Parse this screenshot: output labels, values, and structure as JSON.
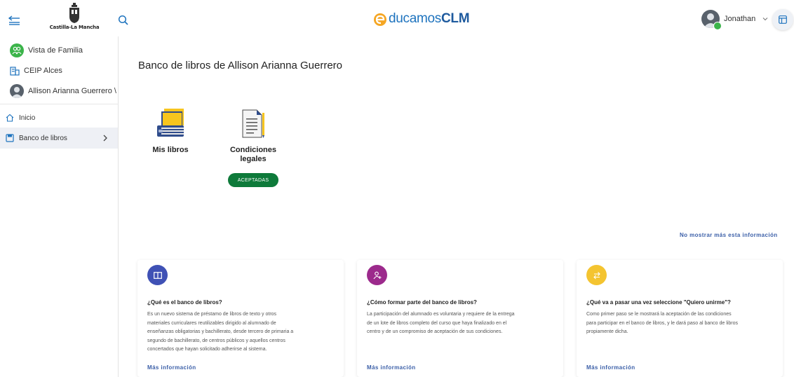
{
  "header": {
    "logo_text": "Castilla-La Mancha",
    "brand_prefix": "ducamos",
    "brand_bold": "CLM",
    "user_name": "Jonathan"
  },
  "sidebar": {
    "context": [
      {
        "label": "Vista de Familia"
      },
      {
        "label": "CEIP Alces"
      },
      {
        "label": "Allison Arianna Guerrero \\"
      }
    ],
    "nav": [
      {
        "label": "Inicio"
      },
      {
        "label": "Banco de libros"
      }
    ]
  },
  "main": {
    "title": "Banco de libros de Allison Arianna Guerrero",
    "tiles": [
      {
        "label": "Mis libros"
      },
      {
        "label_line1": "Condiciones",
        "label_line2": "legales",
        "badge": "ACEPTADAS"
      }
    ],
    "dismiss_link": "No mostrar más esta información",
    "cards": [
      {
        "title": "¿Qué es el banco de libros?",
        "body": [
          "Es un nuevo sistema de préstamo de libros de texto y otros",
          "materiales curriculares reutilizables dirigido al alumnado de",
          "enseñanzas obligatorias y bachillerato, desde tercero de primaria a",
          "segundo de bachillerato, de centros públicos y aquellos centros",
          "concertados que hayan solicitado adherirse al sistema."
        ],
        "link": "Más información",
        "color": "#3f51b5"
      },
      {
        "title": "¿Cómo formar parte del banco de libros?",
        "body": [
          "La participación del alumnado es voluntaria y requiere de la entrega",
          "de un lote de libros completo del curso que haya finalizado en el",
          "centro y de un compromiso de aceptación de sus condiciones."
        ],
        "link": "Más información",
        "color": "#9c2a8c"
      },
      {
        "title": "¿Qué va a pasar una vez seleccione \"Quiero unirme\"?",
        "body": [
          "Como primer paso se le mostrará la aceptación de las condiciones",
          "para participar en el banco de libros, y le dará paso al banco de libros",
          "propiamente dicha."
        ],
        "link": "Más información",
        "color": "#f4c430"
      }
    ]
  },
  "colors": {
    "accent": "#1e73be",
    "badge_green": "#0e7a3a",
    "family_green": "#3bb44a",
    "link_blue": "#3b5fa8"
  }
}
